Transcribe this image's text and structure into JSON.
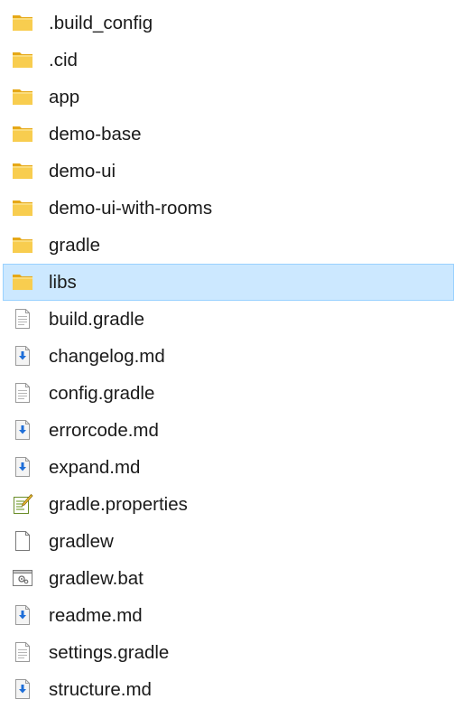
{
  "folders": [
    {
      "name": ".build_config",
      "icon": "folder-icon",
      "selected": false
    },
    {
      "name": ".cid",
      "icon": "folder-icon",
      "selected": false
    },
    {
      "name": "app",
      "icon": "folder-icon",
      "selected": false
    },
    {
      "name": "demo-base",
      "icon": "folder-icon",
      "selected": false
    },
    {
      "name": "demo-ui",
      "icon": "folder-icon",
      "selected": false
    },
    {
      "name": "demo-ui-with-rooms",
      "icon": "folder-icon",
      "selected": false
    },
    {
      "name": "gradle",
      "icon": "folder-icon",
      "selected": false
    },
    {
      "name": "libs",
      "icon": "folder-icon",
      "selected": true
    }
  ],
  "files": [
    {
      "name": "build.gradle",
      "icon": "text-file-icon"
    },
    {
      "name": "changelog.md",
      "icon": "markdown-file-icon"
    },
    {
      "name": "config.gradle",
      "icon": "text-file-icon"
    },
    {
      "name": "errorcode.md",
      "icon": "markdown-file-icon"
    },
    {
      "name": "expand.md",
      "icon": "markdown-file-icon"
    },
    {
      "name": "gradle.properties",
      "icon": "properties-file-icon"
    },
    {
      "name": "gradlew",
      "icon": "blank-file-icon"
    },
    {
      "name": "gradlew.bat",
      "icon": "batch-file-icon"
    },
    {
      "name": "readme.md",
      "icon": "markdown-file-icon"
    },
    {
      "name": "settings.gradle",
      "icon": "text-file-icon"
    },
    {
      "name": "structure.md",
      "icon": "markdown-file-icon"
    }
  ],
  "colors": {
    "folder": "#f7c948",
    "folder_back": "#e6a817",
    "selection_bg": "#cce8ff",
    "selection_border": "#99d1ff",
    "md_arrow": "#1e6ed8"
  }
}
